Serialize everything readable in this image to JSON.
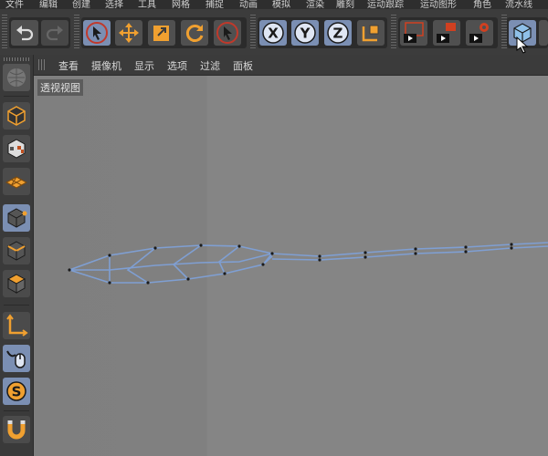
{
  "menu": [
    "文件",
    "编辑",
    "创建",
    "选择",
    "工具",
    "网格",
    "捕捉",
    "动画",
    "模拟",
    "渲染",
    "雕刻",
    "运动跟踪",
    "运动图形",
    "角色",
    "流水线"
  ],
  "toolbar": {
    "undo": "undo-icon",
    "redo": "redo-icon",
    "tools": [
      "select-live-icon",
      "move-icon",
      "scale-icon",
      "rotate-icon",
      "recent-tool-icon"
    ],
    "axes": [
      "X",
      "Y",
      "Z"
    ],
    "coord_system": "world-coordinate-icon",
    "render": [
      "render-view-icon",
      "render-picture-viewer-icon",
      "render-settings-icon"
    ],
    "cube": "cube-object-icon"
  },
  "viewport_menu": [
    "查看",
    "摄像机",
    "显示",
    "选项",
    "过滤",
    "面板"
  ],
  "viewport_label": "透视视图",
  "left_tools": [
    "make-editable-icon",
    "texture-mode-icon",
    "workplane-icon",
    "points-mode-icon",
    "edges-mode-icon",
    "polygons-mode-icon",
    "axis-mode-icon",
    "tweak-mode-icon",
    "snap-icon",
    "magnet-icon"
  ],
  "colors": {
    "active": "#7b8fb3",
    "mesh": "#7f9fd3",
    "accent": "#f0a030"
  }
}
